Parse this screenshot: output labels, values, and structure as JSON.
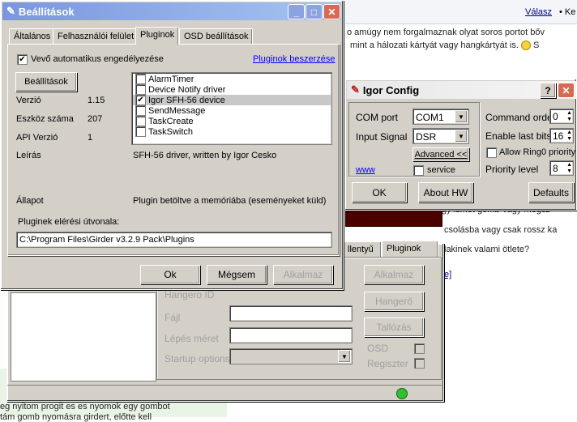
{
  "forum": {
    "reply": "Válasz",
    "ke": "• Ke",
    "line1": "o amúgy nem forgalmaznak olyat soros portot bőv",
    "line2": "mint a hálozati kártyát vagy hangkártyát is.",
    "line2_tail": "S",
    "line3": "gy ismét gomb-vagy megsz",
    "line4": "csolásba vagy csak rossz ka",
    "line5": "lakinek valami ötlete?",
    "line6": "e]",
    "bottom1": "eg nyitom progit es es nyomok egy gombot",
    "bottom2": "tám gomb nyomásra girdert, előtte kell"
  },
  "back_window": {
    "tabs": [
      "llentyű",
      "Pluginok"
    ],
    "buttons": {
      "alkalmaz": "Alkalmaz",
      "hangero": "Hangerő",
      "tallozas": "Tallózás"
    },
    "labels": {
      "hangero_id": "Hangero ID",
      "fajl": "Fájl",
      "lepes": "Lépés méret",
      "startup": "Startup options",
      "osd": "OSD",
      "regiszter": "Regiszter"
    },
    "colors": {
      "led": "#30c030"
    }
  },
  "settings": {
    "title": "Beállítások",
    "tabs": [
      "Általános",
      "Felhasználói felület",
      "Pluginok",
      "OSD beállítások"
    ],
    "selected_tab": "Pluginok",
    "auto_accept": "Vevő automatikus engedélyezése",
    "buy_plugins": "Pluginok beszerzése",
    "settings_btn": "Beállítások",
    "fields": {
      "version_label": "Verzió",
      "version": "1.15",
      "count_label": "Eszköz száma",
      "count": "207",
      "api_label": "API Verzió",
      "api": "1",
      "desc_label": "Leírás",
      "desc": "SFH-56 driver, written by Igor Cesko",
      "state_label": "Állapot",
      "state": "Plugin betöltve a memóriába (eseményeket küld)",
      "path_label": "Pluginek elérési útvonala:",
      "path": "C:\\Program Files\\Girder v3.2.9 Pack\\Plugins"
    },
    "plugins": [
      {
        "name": "AlarmTimer",
        "checked": false
      },
      {
        "name": "Device Notify driver",
        "checked": false
      },
      {
        "name": "Igor SFH-56 device",
        "checked": true
      },
      {
        "name": "SendMessage",
        "checked": false
      },
      {
        "name": "TaskCreate",
        "checked": false
      },
      {
        "name": "TaskSwitch",
        "checked": false
      }
    ],
    "buttons": {
      "ok": "Ok",
      "cancel": "Mégsem",
      "apply": "Alkalmaz"
    }
  },
  "igor": {
    "title": "Igor Config",
    "com_port_label": "COM port",
    "com_port": "COM1",
    "input_signal_label": "Input Signal",
    "input_signal": "DSR",
    "advanced": "Advanced <<",
    "www": "www",
    "service": "service",
    "command_order_label": "Command order",
    "command_order": "0",
    "enable_last_bits_label": "Enable last bits",
    "enable_last_bits": "16",
    "ring0": "Allow Ring0 priority",
    "priority_label": "Priority level",
    "priority": "8",
    "buttons": {
      "ok": "OK",
      "about": "About HW",
      "defaults": "Defaults"
    },
    "help": "?",
    "close": "✕"
  }
}
